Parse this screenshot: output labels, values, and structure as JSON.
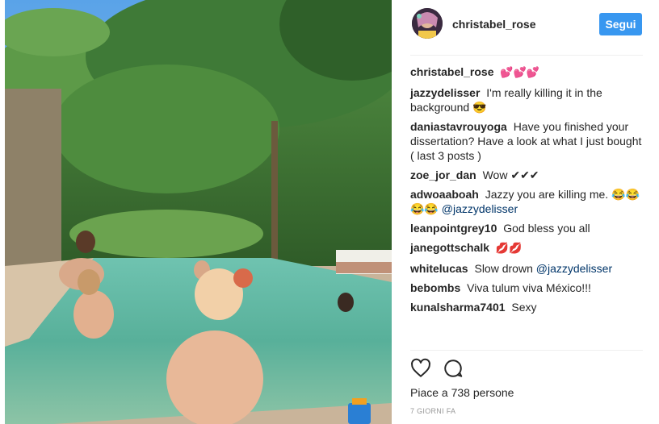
{
  "post": {
    "author": "christabel_rose",
    "follow_label": "Segui",
    "caption_user": "christabel_rose",
    "caption_text": "💕💕💕",
    "likes_text": "Piace a 738 persone",
    "time_text": "7 GIORNI FA"
  },
  "comments": [
    {
      "user": "jazzydelisser",
      "text": "I'm really killing it in the background 😎"
    },
    {
      "user": "daniastavrouyoga",
      "text": "Have you finished your dissertation? Have a look at what I just bought ( last 3 posts )"
    },
    {
      "user": "zoe_jor_dan",
      "text": "Wow ✔✔✔"
    },
    {
      "user": "adwoaaboah",
      "text": "Jazzy you are killing me. 😂😂😂😂",
      "mention": "@jazzydelisser"
    },
    {
      "user": "leanpointgrey10",
      "text": "God bless you all"
    },
    {
      "user": "janegottschalk",
      "text": "💋💋"
    },
    {
      "user": "whitelucas",
      "text": "Slow drown",
      "mention": "@jazzydelisser"
    },
    {
      "user": "bebombs",
      "text": "Viva tulum viva México!!!"
    },
    {
      "user": "kunalsharma7401",
      "text": "Sexy"
    }
  ],
  "icons": {
    "like": "heart-icon",
    "comment": "comment-bubble-icon"
  },
  "colors": {
    "follow_button": "#3897f0",
    "text": "#262626",
    "muted": "#999999",
    "mention": "#003569"
  }
}
